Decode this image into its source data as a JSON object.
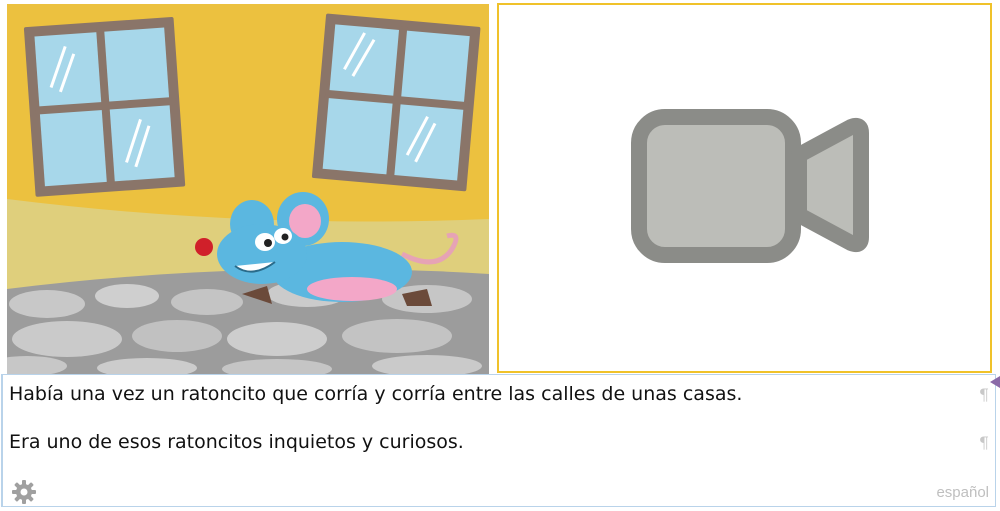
{
  "story": {
    "line1": "Había una vez un ratoncito que corría y corría entre las calles de unas casas.",
    "line2": "Era uno de esos ratoncitos inquietos y curiosos.",
    "paragraph_mark": "¶"
  },
  "footer": {
    "language": "español",
    "settings_icon": "gear-icon"
  },
  "media": {
    "illustration_icon": "mouse-illustration",
    "video_icon": "video-camera-icon"
  },
  "colors": {
    "video_border": "#f0c22a",
    "text_border": "#b9d3ea",
    "camera_body": "#8b8c88",
    "camera_fill": "#bcbdb8"
  }
}
